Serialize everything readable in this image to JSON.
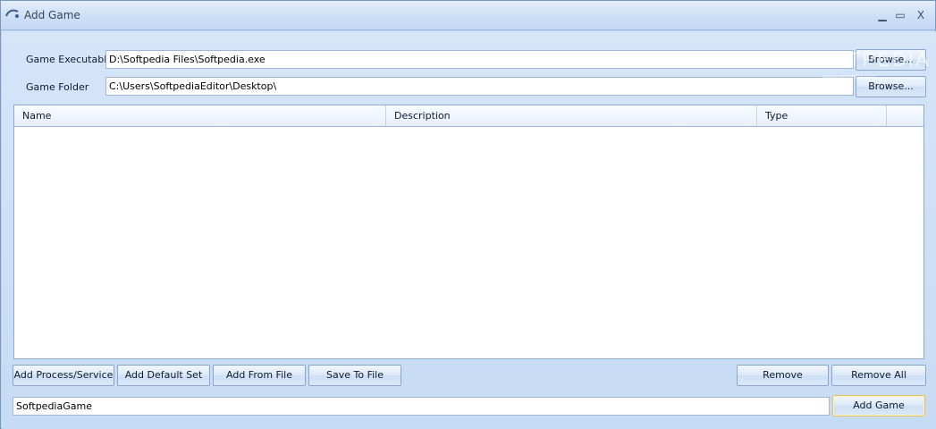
{
  "window": {
    "title": "Add Game",
    "controls": {
      "minimize": "▁",
      "maximize": "▭",
      "close": "X"
    }
  },
  "form": {
    "exe_label": "Game Executable",
    "exe_value": "D:\\Softpedia Files\\Softpedia.exe",
    "folder_label": "Game Folder",
    "folder_value": "C:\\Users\\SoftpediaEditor\\Desktop\\",
    "browse_label": "Browse..."
  },
  "list": {
    "columns": [
      "Name",
      "Description",
      "Type"
    ],
    "rows": []
  },
  "actions": {
    "add_process": "Add Process/Service",
    "add_default": "Add Default Set",
    "add_from_file": "Add From File",
    "save_to_file": "Save To File",
    "remove": "Remove",
    "remove_all": "Remove All"
  },
  "footer": {
    "game_name_value": "SoftpediaGame",
    "add_game": "Add Game"
  },
  "watermark": {
    "text": "SOFTPEDIA",
    "sub": "www.softpedia.com"
  },
  "colors": {
    "accent": "#bfd6f3",
    "border": "#8aa6cc",
    "default_button_border": "#e6c25e"
  },
  "icons": {
    "title": "app-logo-icon"
  }
}
